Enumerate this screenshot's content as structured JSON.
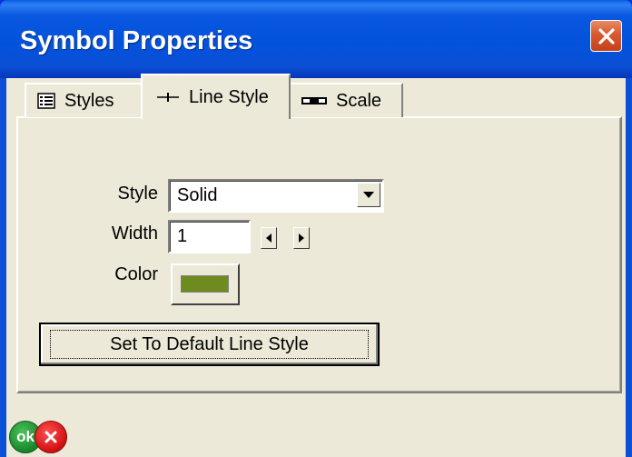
{
  "window": {
    "title": "Symbol Properties"
  },
  "tabs": [
    {
      "label": "Styles",
      "icon": "list-icon",
      "selected": false
    },
    {
      "label": "Line Style",
      "icon": "line-style-icon",
      "selected": true
    },
    {
      "label": "Scale",
      "icon": "scale-icon",
      "selected": false
    }
  ],
  "line_style": {
    "style_label": "Style",
    "style_value": "Solid",
    "width_label": "Width",
    "width_value": "1",
    "color_label": "Color",
    "color_value": "#6e8b1f",
    "default_button_label": "Set To Default Line Style"
  },
  "footer": {
    "ok_label": "ok",
    "cancel_icon": "cancel-icon"
  },
  "colors": {
    "titlebar": "#0353dd",
    "face": "#ece9d8",
    "close": "#d9582e"
  }
}
